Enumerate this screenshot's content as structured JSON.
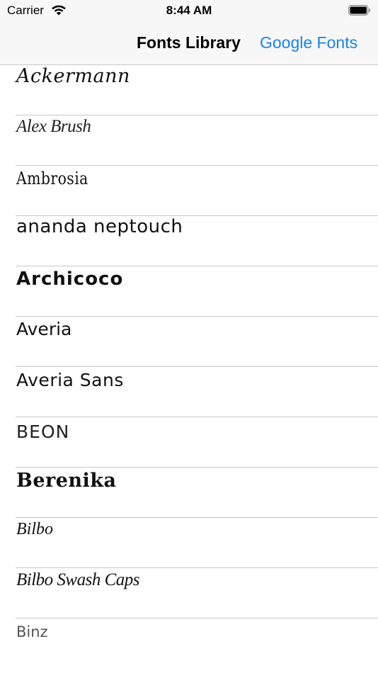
{
  "status_bar": {
    "carrier": "Carrier",
    "time": "8:44 AM",
    "icons": [
      "wifi-icon",
      "battery-icon"
    ]
  },
  "nav_bar": {
    "title": "Fonts Library",
    "right_button": "Google Fonts",
    "accent_color": "#1a82f0"
  },
  "fonts": [
    "Ackermann",
    "Alex Brush",
    "Ambrosia",
    "ananda neptouch",
    "Archicoco",
    "Averia",
    "Averia Sans",
    "BEON",
    "Berenika",
    "Bilbo",
    "Bilbo Swash Caps",
    "Binz"
  ]
}
